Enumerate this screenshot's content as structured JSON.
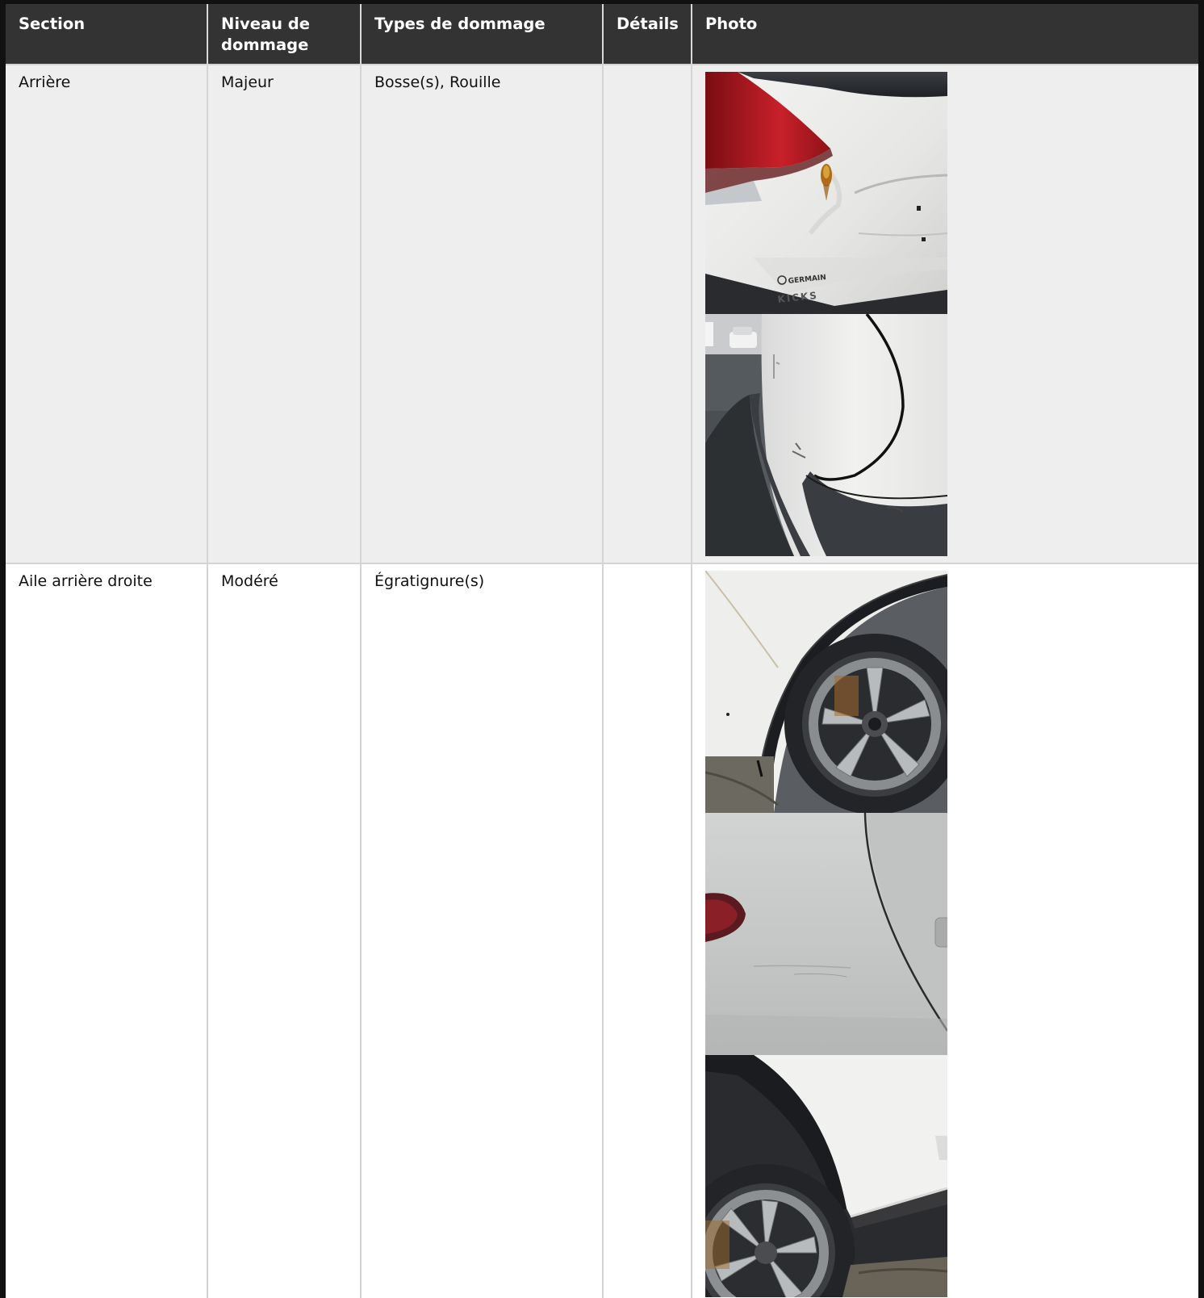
{
  "table": {
    "headers": {
      "section": "Section",
      "level": "Niveau de dommage",
      "types": "Types de dommage",
      "details": "Détails",
      "photo": "Photo"
    },
    "rows": [
      {
        "section": "Arrière",
        "level": "Majeur",
        "types": "Bosse(s), Rouille",
        "details": "",
        "photos": [
          {
            "subject": "rear-hatch-dent-rust",
            "badge_line1": "GERMAIN",
            "badge_line2": "KICKS"
          },
          {
            "subject": "rear-corner-bumper"
          }
        ]
      },
      {
        "section": "Aile arrière droite",
        "level": "Modéré",
        "types": "Égratignure(s)",
        "details": "",
        "photos": [
          {
            "subject": "rear-wheel-arch"
          },
          {
            "subject": "rear-quarter-panel-scratch"
          },
          {
            "subject": "wheel-arch-low-angle"
          }
        ]
      }
    ]
  }
}
